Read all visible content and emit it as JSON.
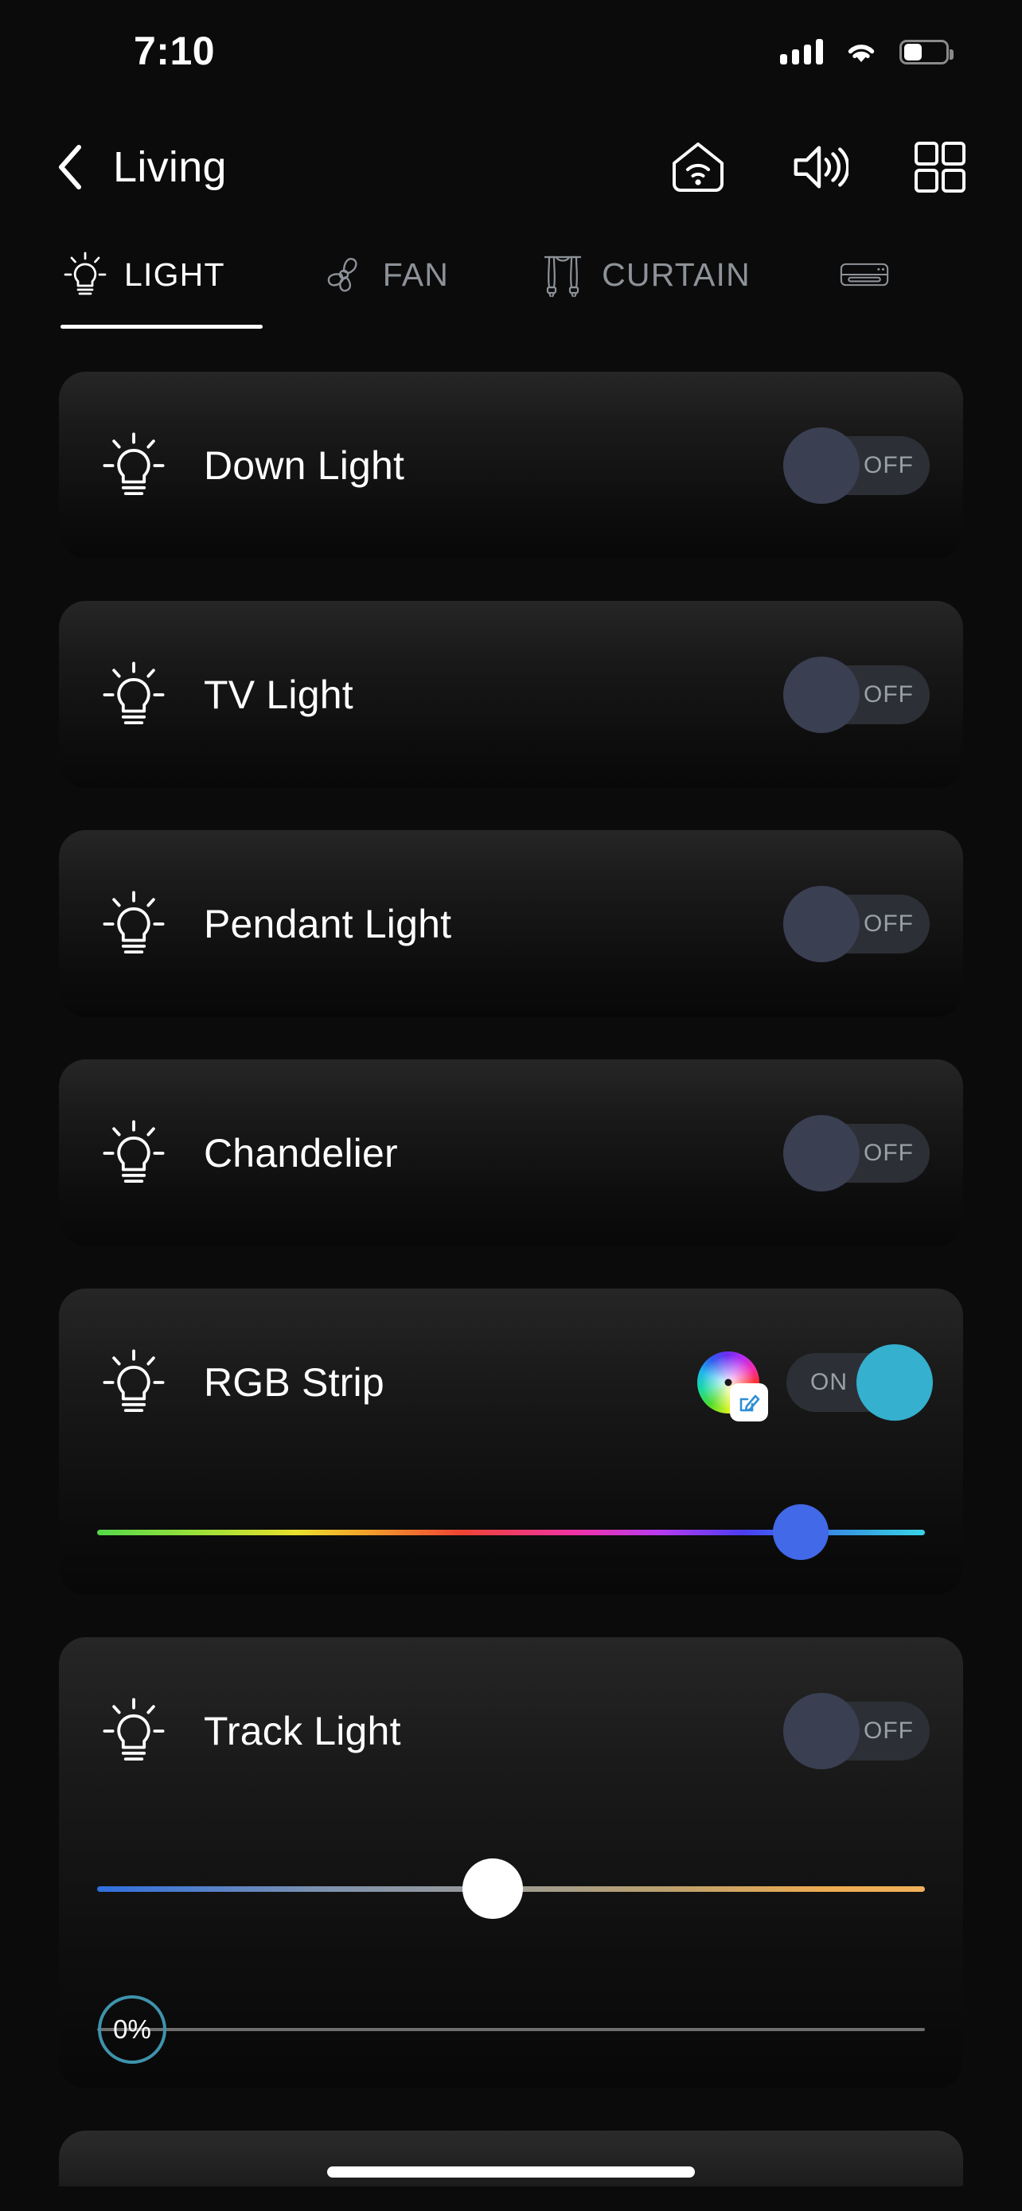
{
  "status_bar": {
    "time": "7:10",
    "signal_icon": "cellular-signal-icon",
    "signal_bars": 4,
    "wifi_icon": "wifi-icon",
    "battery_icon": "battery-icon",
    "battery_percent": 42
  },
  "header": {
    "back_icon": "chevron-left-icon",
    "title": "Living",
    "icons": [
      {
        "name": "home-wifi-icon",
        "label": "Home"
      },
      {
        "name": "speaker-volume-icon",
        "label": "Volume"
      },
      {
        "name": "grid-view-icon",
        "label": "Grid"
      }
    ]
  },
  "tabs": {
    "active_index": 0,
    "items": [
      {
        "label": "LIGHT",
        "icon": "light-bulb-icon",
        "active": true
      },
      {
        "label": "FAN",
        "icon": "fan-icon",
        "active": false
      },
      {
        "label": "CURTAIN",
        "icon": "curtain-icon",
        "active": false
      },
      {
        "label": "",
        "icon": "air-conditioner-icon",
        "active": false
      }
    ]
  },
  "devices": [
    {
      "name": "Down Light",
      "icon": "light-bulb-icon",
      "toggle": {
        "state": "off",
        "label": "OFF"
      },
      "has_color_wheel": false,
      "sliders": []
    },
    {
      "name": "TV Light",
      "icon": "light-bulb-icon",
      "toggle": {
        "state": "off",
        "label": "OFF"
      },
      "has_color_wheel": false,
      "sliders": []
    },
    {
      "name": "Pendant Light",
      "icon": "light-bulb-icon",
      "toggle": {
        "state": "off",
        "label": "OFF"
      },
      "has_color_wheel": false,
      "sliders": []
    },
    {
      "name": "Chandelier",
      "icon": "light-bulb-icon",
      "toggle": {
        "state": "off",
        "label": "OFF"
      },
      "has_color_wheel": false,
      "sliders": []
    },
    {
      "name": "RGB Strip",
      "icon": "light-bulb-icon",
      "toggle": {
        "state": "on",
        "label": "ON"
      },
      "has_color_wheel": true,
      "color_wheel": {
        "icon": "color-wheel-icon",
        "badge_icon": "edit-pencil-icon"
      },
      "sliders": [
        {
          "type": "hue",
          "name": "hue-slider",
          "position_percent": 82,
          "thumb_color": "#4169e8",
          "value_label": ""
        }
      ]
    },
    {
      "name": "Track Light",
      "icon": "light-bulb-icon",
      "toggle": {
        "state": "off",
        "label": "OFF"
      },
      "has_color_wheel": false,
      "sliders": [
        {
          "type": "cct",
          "name": "color-temperature-slider",
          "position_percent": 48,
          "thumb_color": "#ffffff",
          "value_label": ""
        },
        {
          "type": "brightness",
          "name": "brightness-slider",
          "position_percent": 0,
          "thumb_color": "#3f93ad",
          "value_label": "0%"
        }
      ]
    }
  ],
  "colors": {
    "background": "#0b0b0b",
    "card_top": "#262626",
    "card_bottom": "#080808",
    "toggle_off_knob": "#3a3f52",
    "toggle_on_knob": "#35b0cf",
    "toggle_track": "#2c2f35",
    "accent_teal": "#3f93ad",
    "text_primary": "#ffffff",
    "text_muted": "#8d9298"
  },
  "home_indicator": "home-indicator"
}
